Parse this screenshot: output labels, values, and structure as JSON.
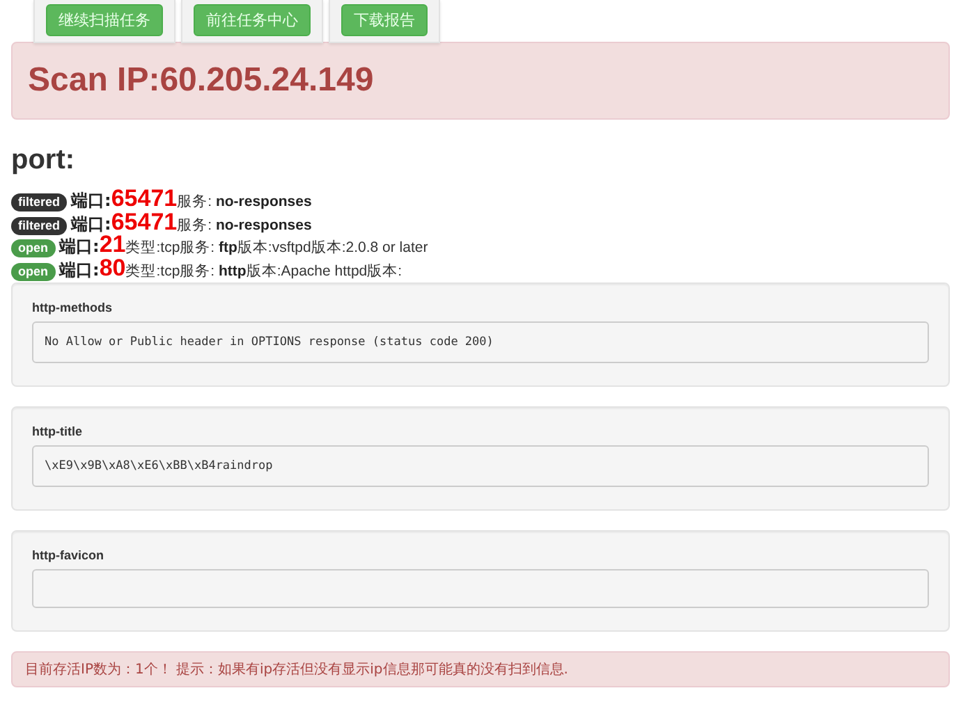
{
  "buttons": [
    "继续扫描任务",
    "前往任务中心",
    "下载报告"
  ],
  "scan_title": "Scan IP:60.205.24.149",
  "port_heading": "port:",
  "ports": [
    {
      "status": "filtered",
      "kind": "filtered",
      "port_label": "端口:",
      "port": "65471",
      "details": "服务: **no-responses**"
    },
    {
      "status": "filtered",
      "kind": "filtered",
      "port_label": "端口:",
      "port": "65471",
      "details": "服务: **no-responses**"
    },
    {
      "status": "open",
      "kind": "open",
      "port_label": "端口:",
      "port": "21",
      "details": "类型:tcp服务: **ftp**版本:vsftpd版本:2.0.8 or later"
    },
    {
      "status": "open",
      "kind": "open",
      "port_label": "端口:",
      "port": "80",
      "details": "类型:tcp服务: **http**版本:Apache httpd版本:"
    }
  ],
  "scripts": [
    {
      "name": "http-methods",
      "output": "No Allow or Public header in OPTIONS response (status code 200)"
    },
    {
      "name": "http-title",
      "output": "\\xE9\\x9B\\xA8\\xE6\\xBB\\xB4raindrop"
    },
    {
      "name": "http-favicon"
    }
  ],
  "footer_alert": "目前存活IP数为：1个！ 提示：如果有ip存活但没有显示ip信息那可能真的没有扫到信息."
}
